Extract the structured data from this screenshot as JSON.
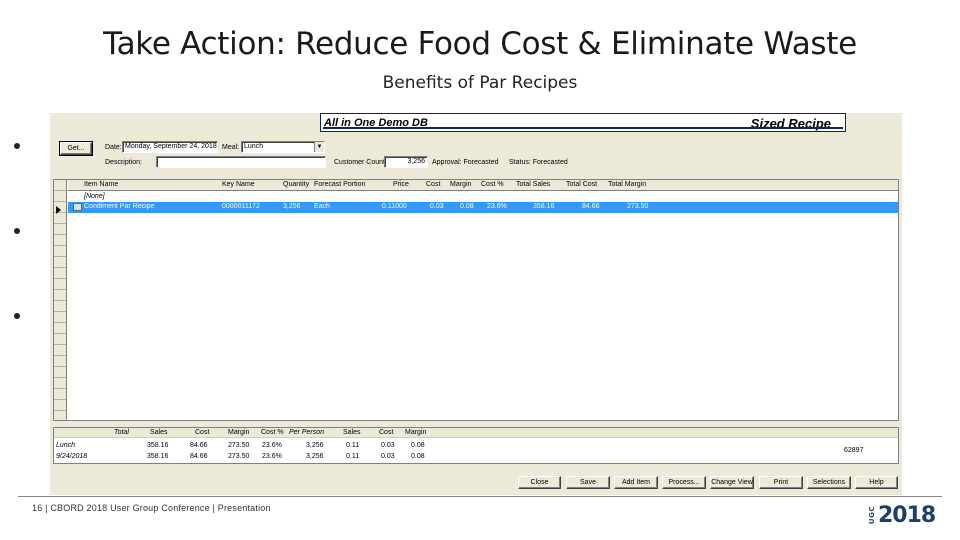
{
  "slide": {
    "title": "Take Action:  Reduce Food Cost & Eliminate Waste",
    "subtitle": "Benefits of Par Recipes",
    "footer": "16 | CBORD 2018 User Group Conference | Presentation",
    "logo_small": "UGC",
    "logo_year": "2018"
  },
  "window": {
    "db_name": "All in One Demo DB",
    "title": "Sized Recipe",
    "get_button": "Get...",
    "date_label": "Date:",
    "date_value": "Monday, September 24, 2018",
    "meal_label": "Meal:",
    "meal_value": "Lunch",
    "description_label": "Description:",
    "description_value": "",
    "customer_count_label": "Customer Count:",
    "customer_count_value": "3,256",
    "approval_label": "Approval: Forecasted",
    "status_label": "Status: Forecasted"
  },
  "grid": {
    "columns": [
      "Item Name",
      "Key Name",
      "Quantity",
      "Forecast Portion",
      "Price",
      "Cost",
      "Margin",
      "Cost %",
      "Total Sales",
      "Total Cost",
      "Total Margin"
    ],
    "none_row": "[None]",
    "rows": [
      {
        "item_name": "Condiment Par Recipe",
        "key_name": "0000011172",
        "quantity": "3,256",
        "forecast_portion": "Each",
        "price": "0.11000",
        "cost": "0.03",
        "margin": "0.08",
        "cost_pct": "23.6%",
        "total_sales": "358.16",
        "total_cost": "84.66",
        "total_margin": "273.50"
      }
    ]
  },
  "summary": {
    "headers": [
      "Total",
      "Sales",
      "Cost",
      "Margin",
      "Cost %",
      "Per Person",
      "Sales",
      "Cost",
      "Margin"
    ],
    "rows": [
      {
        "label": "Lunch",
        "sales": "358.16",
        "cost": "84.66",
        "margin": "273.50",
        "cost_pct": "23.6%",
        "per_person": "3,256",
        "pp_sales": "0.11",
        "pp_cost": "0.03",
        "pp_margin": "0.08"
      },
      {
        "label": "9/24/2018",
        "sales": "358.16",
        "cost": "84.66",
        "margin": "273.50",
        "cost_pct": "23.6%",
        "per_person": "3,256",
        "pp_sales": "0.11",
        "pp_cost": "0.03",
        "pp_margin": "0.08"
      }
    ],
    "id_value": "62897"
  },
  "buttons": {
    "close": "Close",
    "save": "Save",
    "add_item": "Add Item",
    "process": "Process...",
    "change_view": "Change View",
    "print": "Print",
    "selections": "Selections",
    "help": "Help"
  }
}
